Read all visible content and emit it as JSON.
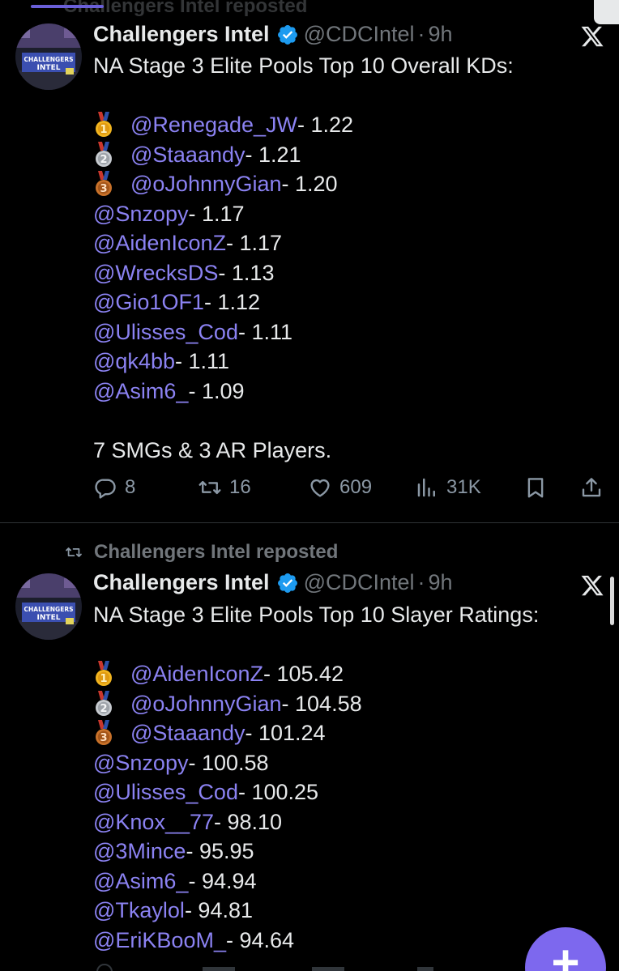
{
  "top_fragment": {
    "text": "Challengers Intel reposted"
  },
  "tweets": [
    {
      "author": {
        "name": "Challengers Intel",
        "handle": "@CDCIntel",
        "time": "9h",
        "avatar_text": [
          "CHALLENGERS",
          "INTEL"
        ]
      },
      "title": "NA Stage 3 Elite Pools Top 10 Overall KDs:",
      "entries": [
        {
          "medal": "1",
          "handle": "@Renegade_JW",
          "value": " - 1.22"
        },
        {
          "medal": "2",
          "handle": "@Staaandy",
          "value": " - 1.21"
        },
        {
          "medal": "3",
          "handle": "@oJohnnyGian",
          "value": " - 1.20"
        },
        {
          "handle": "@Snzopy",
          "value": " - 1.17"
        },
        {
          "handle": "@AidenIconZ",
          "value": " - 1.17"
        },
        {
          "handle": "@WrecksDS",
          "value": " - 1.13"
        },
        {
          "handle": "@Gio1OF1",
          "value": " - 1.12"
        },
        {
          "handle": "@Ulisses_Cod",
          "value": " - 1.11"
        },
        {
          "handle": "@qk4bb",
          "value": " - 1.11"
        },
        {
          "handle": "@Asim6_",
          "value": " - 1.09"
        }
      ],
      "footer": "7 SMGs & 3 AR Players.",
      "actions": {
        "replies": "8",
        "reposts": "16",
        "likes": "609",
        "views": "31K"
      }
    },
    {
      "repost_label": "Challengers Intel reposted",
      "author": {
        "name": "Challengers Intel",
        "handle": "@CDCIntel",
        "time": "9h",
        "avatar_text": [
          "CHALLENGERS",
          "INTEL"
        ]
      },
      "title": "NA Stage 3 Elite Pools Top 10 Slayer Ratings:",
      "entries": [
        {
          "medal": "1",
          "handle": "@AidenIconZ",
          "value": " - 105.42"
        },
        {
          "medal": "2",
          "handle": "@oJohnnyGian",
          "value": " - 104.58"
        },
        {
          "medal": "3",
          "handle": "@Staaandy",
          "value": " - 101.24"
        },
        {
          "handle": "@Snzopy",
          "value": " - 100.58"
        },
        {
          "handle": "@Ulisses_Cod",
          "value": " - 100.25"
        },
        {
          "handle": "@Knox__77",
          "value": " - 98.10"
        },
        {
          "handle": "@3Mince",
          "value": " - 95.95"
        },
        {
          "handle": "@Asim6_",
          "value": " - 94.94"
        },
        {
          "handle": "@Tkaylol",
          "value": " - 94.81"
        },
        {
          "handle": "@EriKBooM_",
          "value": " - 94.64"
        }
      ]
    }
  ],
  "fab": {
    "label": "+"
  },
  "colors": {
    "background": "#000000",
    "text": "#e7e9ea",
    "muted": "#71767b",
    "mention": "#8b82f2",
    "verified": "#1d9bf0",
    "fab": "#7d68ee",
    "gold": "#f2b51f",
    "silver": "#b8bcc1",
    "bronze": "#b8631f"
  },
  "icons": {
    "verified": "verified-badge-icon",
    "brand": "x-logo-icon",
    "reply": "reply-icon",
    "repost": "repost-icon",
    "like": "heart-icon",
    "views": "views-icon",
    "bookmark": "bookmark-icon",
    "share": "share-icon",
    "medal_1": "gold-medal-icon",
    "medal_2": "silver-medal-icon",
    "medal_3": "bronze-medal-icon"
  }
}
